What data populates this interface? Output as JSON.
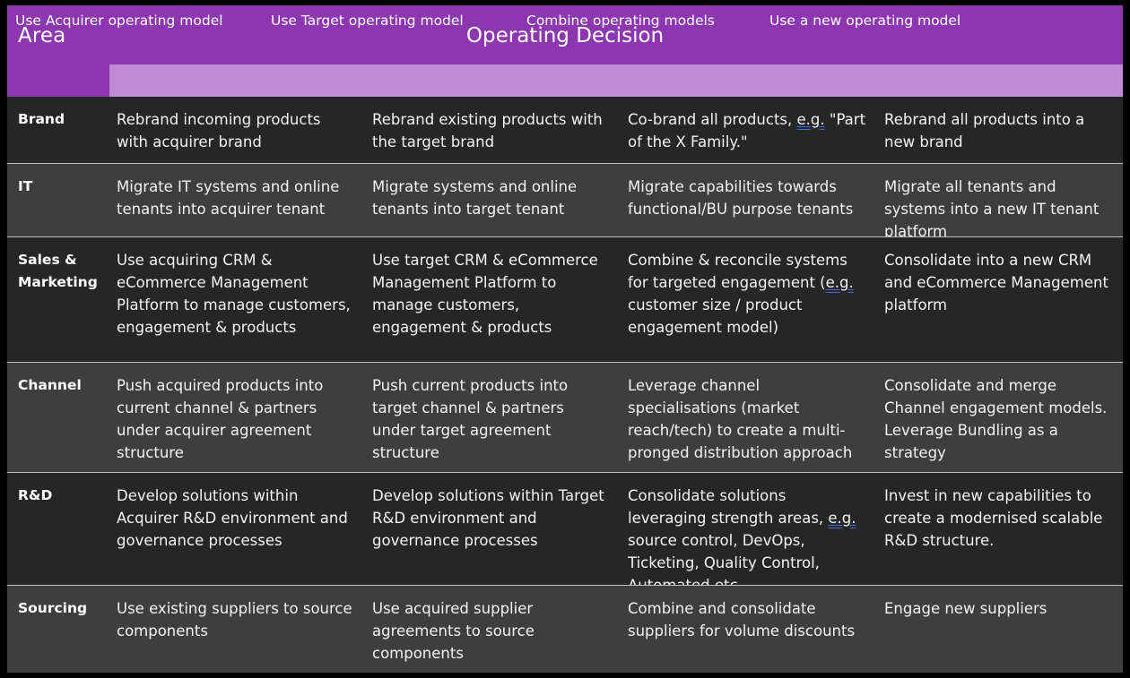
{
  "header": {
    "area_label": "Area",
    "decision_label": "Operating Decision",
    "columns": [
      "Use Acquirer operating model",
      "Use Target operating model",
      "Combine operating models",
      "Use a new operating model"
    ]
  },
  "colors": {
    "header_purple": "#8C37AF",
    "subheader_purple": "#C08CD6",
    "row_dark": "#262626",
    "row_light": "#3E3E3E",
    "row_separator": "#C0C0C0",
    "frame": "#000000",
    "text": "#F2F2F2",
    "spellcheck_underline": "#3A6FD8"
  },
  "rows": [
    {
      "area": "Brand",
      "cells": [
        {
          "text": "Rebrand incoming products with acquirer brand"
        },
        {
          "text": "Rebrand existing products with the target brand"
        },
        {
          "pre": "Co-brand all products, ",
          "spell": "e.g.",
          "post": " \"Part of the X Family.\""
        },
        {
          "text": "Rebrand all products into a new brand"
        }
      ]
    },
    {
      "area": "IT",
      "cells": [
        {
          "text": "Migrate IT systems and online tenants into acquirer tenant"
        },
        {
          "text": "Migrate systems and online tenants into target tenant"
        },
        {
          "text": "Migrate capabilities towards functional/BU purpose tenants"
        },
        {
          "text": "Migrate all tenants and systems into a new IT tenant platform"
        }
      ]
    },
    {
      "area": "Sales & Marketing",
      "cells": [
        {
          "text": "Use acquiring CRM & eCommerce Management Platform to manage customers, engagement & products"
        },
        {
          "text": "Use target CRM & eCommerce Management Platform to manage customers, engagement & products"
        },
        {
          "pre": "Combine & reconcile systems for targeted engagement (",
          "spell": "e.g.",
          "post": " customer size / product engagement model)"
        },
        {
          "text": "Consolidate into a new CRM and eCommerce Management platform"
        }
      ]
    },
    {
      "area": "Channel",
      "cells": [
        {
          "text": "Push acquired products into current channel & partners under acquirer agreement structure"
        },
        {
          "text": "Push current products into target channel & partners under target agreement structure"
        },
        {
          "text": "Leverage channel specialisations (market reach/tech) to create a multi-pronged distribution approach"
        },
        {
          "text": "Consolidate and merge Channel engagement models. Leverage Bundling as a strategy"
        }
      ]
    },
    {
      "area": "R&D",
      "cells": [
        {
          "text": "Develop solutions within Acquirer R&D environment and governance processes"
        },
        {
          "text": "Develop solutions within Target R&D environment and governance processes"
        },
        {
          "pre": "Consolidate solutions leveraging strength areas, ",
          "spell": "e.g.",
          "post": " source control, DevOps, Ticketing, Quality Control, Automated etc."
        },
        {
          "text": "Invest in new capabilities to create a modernised scalable R&D structure."
        }
      ]
    },
    {
      "area": "Sourcing",
      "cells": [
        {
          "text": "Use existing suppliers to source components"
        },
        {
          "text": "Use acquired supplier agreements to source components"
        },
        {
          "text": "Combine and consolidate suppliers for volume discounts"
        },
        {
          "text": "Engage new suppliers"
        }
      ]
    }
  ]
}
